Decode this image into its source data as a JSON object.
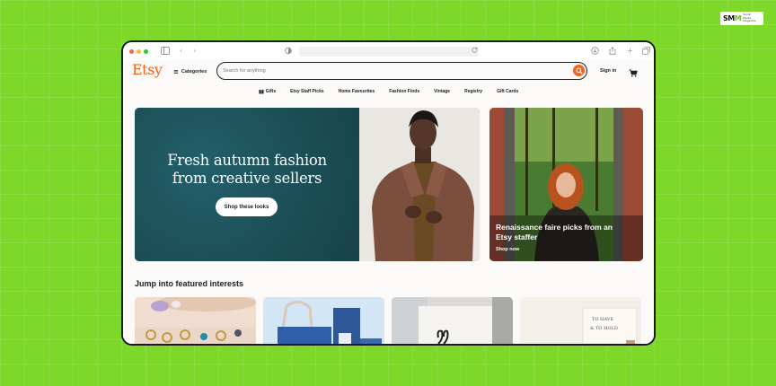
{
  "watermark": {
    "logo_text": "SM",
    "logo_accent": "M",
    "tagline": "Social Media Magazine"
  },
  "colors": {
    "background": "#7dd82a",
    "etsy_orange": "#f1641e",
    "hero_teal": "#1f5359"
  },
  "header": {
    "logo": "Etsy",
    "categories_label": "Categories",
    "search_placeholder": "Search for anything",
    "sign_in": "Sign in"
  },
  "nav": {
    "items": [
      "Gifts",
      "Etsy Staff Picks",
      "Home Favourites",
      "Fashion Finds",
      "Vintage",
      "Registry",
      "Gift Cards"
    ]
  },
  "hero": {
    "title_line1": "Fresh autumn fashion",
    "title_line2": "from creative sellers",
    "button_label": "Shop these looks"
  },
  "side_promo": {
    "title": "Renaissance faire picks from an Etsy staffer",
    "link": "Shop now"
  },
  "featured": {
    "title": "Jump into featured interests",
    "tiles": [
      "jewelry",
      "blue-bags",
      "tote-bag",
      "wedding-sign"
    ]
  }
}
